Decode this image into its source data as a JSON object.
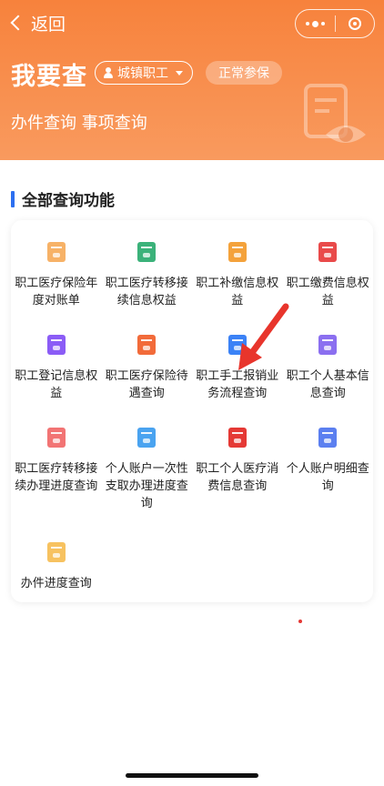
{
  "nav": {
    "back_label": "返回"
  },
  "header": {
    "title": "我要查",
    "insured_type": "城镇职工",
    "status": "正常参保",
    "subtitle": "办件查询 事项查询"
  },
  "section": {
    "title": "全部查询功能"
  },
  "colors": {
    "header_orange": "#f7823c",
    "accent_blue": "#2c6ff0",
    "arrow_red": "#e8352c"
  },
  "functions": [
    {
      "label": "职工医疗保险年度对账单",
      "icon": "annual-statement-icon",
      "color": "#f7b267"
    },
    {
      "label": "职工医疗转移接续信息权益",
      "icon": "transfer-info-icon",
      "color": "#3bb27a"
    },
    {
      "label": "职工补缴信息权益",
      "icon": "supplementary-payment-icon",
      "color": "#f4a23b"
    },
    {
      "label": "职工缴费信息权益",
      "icon": "payment-info-icon",
      "color": "#e94a4a"
    },
    {
      "label": "职工登记信息权益",
      "icon": "registration-info-icon",
      "color": "#8b5cf6"
    },
    {
      "label": "职工医疗保险待遇查询",
      "icon": "benefit-query-icon",
      "color": "#f26b3a"
    },
    {
      "label": "职工手工报销业务流程查询",
      "icon": "manual-reimbursement-icon",
      "color": "#3b82f6"
    },
    {
      "label": "职工个人基本信息查询",
      "icon": "personal-info-icon",
      "color": "#8b6ff0"
    },
    {
      "label": "职工医疗转移接续办理进度查询",
      "icon": "transfer-progress-icon",
      "color": "#f27474"
    },
    {
      "label": "个人账户一次性支取办理进度查询",
      "icon": "account-withdrawal-icon",
      "color": "#4aa3f0"
    },
    {
      "label": "职工个人医疗消费信息查询",
      "icon": "medical-consumption-icon",
      "color": "#e53935"
    },
    {
      "label": "个人账户明细查询",
      "icon": "account-detail-icon",
      "color": "#5b7ff0"
    },
    {
      "label": "办件进度查询",
      "icon": "case-progress-icon",
      "color": "#f7c260"
    }
  ]
}
